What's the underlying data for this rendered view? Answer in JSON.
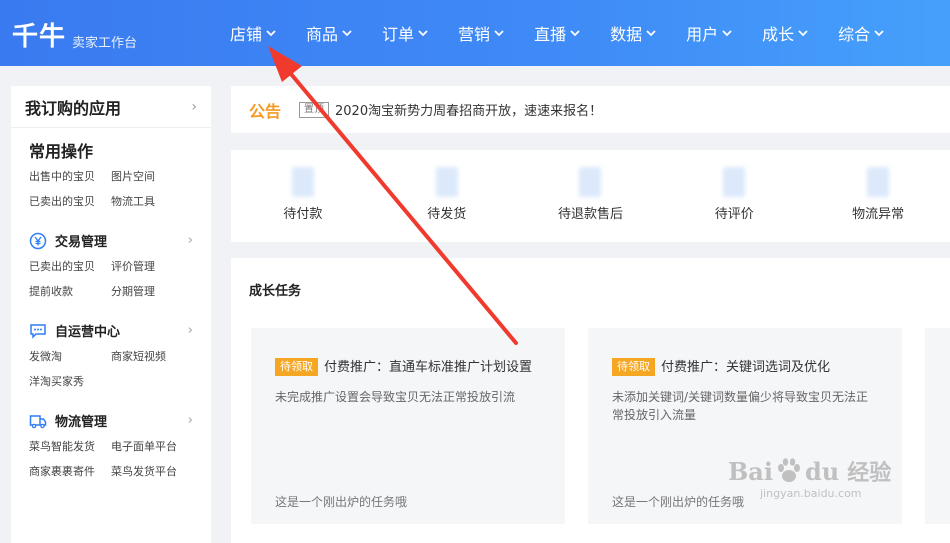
{
  "header": {
    "logo": "千牛",
    "subtitle": "卖家工作台",
    "nav": [
      "店铺",
      "商品",
      "订单",
      "营销",
      "直播",
      "数据",
      "用户",
      "成长",
      "综合"
    ]
  },
  "sidebar": {
    "title": "我订购的应用",
    "common": {
      "title": "常用操作",
      "links": [
        "出售中的宝贝",
        "图片空间",
        "已卖出的宝贝",
        "物流工具"
      ]
    },
    "trade": {
      "title": "交易管理",
      "links": [
        "已卖出的宝贝",
        "评价管理",
        "提前收款",
        "分期管理"
      ]
    },
    "ops": {
      "title": "自运营中心",
      "links": [
        "发微淘",
        "商家短视频",
        "洋淘买家秀"
      ]
    },
    "logistics": {
      "title": "物流管理",
      "links": [
        "菜鸟智能发货",
        "电子面单平台",
        "商家裹裹寄件",
        "菜鸟发货平台"
      ]
    }
  },
  "announcement": {
    "title": "公告",
    "tag": "置顶",
    "text": "2020淘宝新势力周春招商开放，速速来报名！"
  },
  "orders": [
    "待付款",
    "待发货",
    "待退款售后",
    "待评价",
    "物流异常"
  ],
  "tasks": {
    "title": "成长任务",
    "cards": [
      {
        "badge": "待领取",
        "title": "付费推广：直通车标准推广计划设置",
        "desc": "未完成推广设置会导致宝贝无法正常投放引流",
        "footer": "这是一个刚出炉的任务哦"
      },
      {
        "badge": "待领取",
        "title": "付费推广：关键词选词及优化",
        "desc": "未添加关键词/关键词数量偏少将导致宝贝无法正常投放引入流量",
        "footer": "这是一个刚出炉的任务哦"
      }
    ]
  },
  "watermark": {
    "brand": "Bai",
    "brand2": "du",
    "cn": "经验",
    "url": "jingyan.baidu.com"
  },
  "colors": {
    "header_blue": "#3f8bf7",
    "accent_orange": "#f5a623",
    "annotation_red": "#f03a2e"
  }
}
